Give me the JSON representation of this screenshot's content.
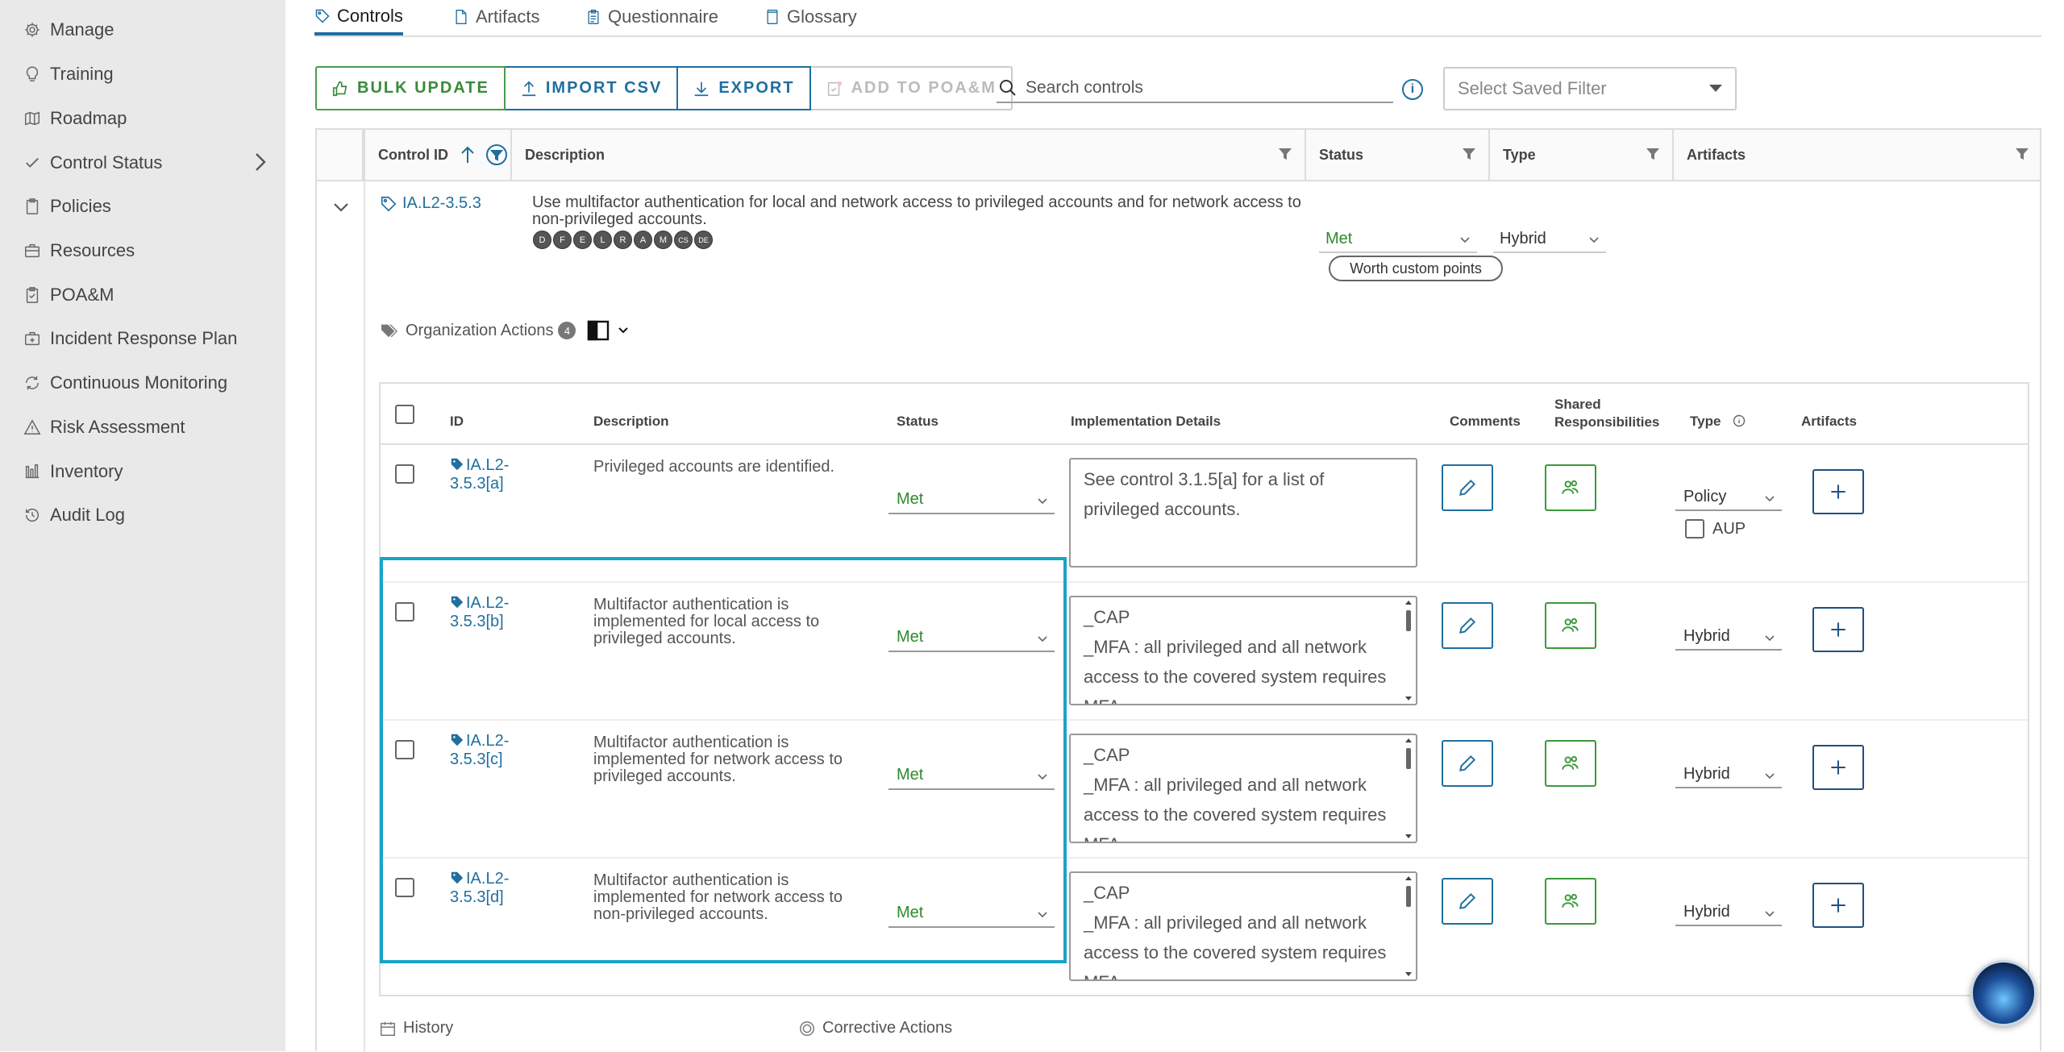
{
  "sidebar": {
    "items": [
      {
        "label": "Manage",
        "icon": "gear-icon"
      },
      {
        "label": "Training",
        "icon": "lightbulb-icon"
      },
      {
        "label": "Roadmap",
        "icon": "map-icon"
      },
      {
        "label": "Control Status",
        "icon": "checkmark-icon"
      },
      {
        "label": "Policies",
        "icon": "clipboard-icon"
      },
      {
        "label": "Resources",
        "icon": "briefcase-icon"
      },
      {
        "label": "POA&M",
        "icon": "clipboard-check-icon"
      },
      {
        "label": "Incident Response Plan",
        "icon": "first-aid-icon"
      },
      {
        "label": "Continuous Monitoring",
        "icon": "cycle-icon"
      },
      {
        "label": "Risk Assessment",
        "icon": "warning-icon"
      },
      {
        "label": "Inventory",
        "icon": "bar-chart-icon"
      },
      {
        "label": "Audit Log",
        "icon": "history-icon"
      }
    ]
  },
  "tabs": [
    "Controls",
    "Artifacts",
    "Questionnaire",
    "Glossary"
  ],
  "toolbar": {
    "bulk_update": "BULK UPDATE",
    "import_csv": "IMPORT CSV",
    "export": "EXPORT",
    "add_poam": "ADD TO POA&M",
    "search_placeholder": "Search controls",
    "saved_filter_placeholder": "Select Saved Filter"
  },
  "grid_headers": {
    "control_id": "Control ID",
    "description": "Description",
    "status": "Status",
    "type": "Type",
    "artifacts": "Artifacts"
  },
  "control": {
    "id": "IA.L2-3.5.3",
    "description": "Use multifactor authentication for local and network access to privileged accounts and for network access to non-privileged accounts.",
    "badges": [
      "D",
      "F",
      "E",
      "L",
      "R",
      "A",
      "M",
      "CS",
      "DE"
    ],
    "status": "Met",
    "type": "Hybrid",
    "points_pill": "Worth custom points"
  },
  "org_actions": {
    "label": "Organization Actions",
    "count": "4",
    "headers": {
      "id": "ID",
      "description": "Description",
      "status": "Status",
      "implementation": "Implementation Details",
      "comments": "Comments",
      "shared": "Shared Responsibilities",
      "type": "Type",
      "artifacts": "Artifacts"
    },
    "rows": [
      {
        "id": "IA.L2-3.5.3[a]",
        "description": "Privileged accounts are identified.",
        "status": "Met",
        "impl": "See control 3.1.5[a] for a list of privileged accounts.",
        "type": "Policy",
        "aup_label": "AUP"
      },
      {
        "id": "IA.L2-3.5.3[b]",
        "description": "Multifactor authentication is implemented for local access to privileged accounts.",
        "status": "Met",
        "impl": "_CAP\n_MFA : all privileged and all network access to the covered system requires MFA",
        "type": "Hybrid"
      },
      {
        "id": "IA.L2-3.5.3[c]",
        "description": "Multifactor authentication is implemented for network access to privileged accounts.",
        "status": "Met",
        "impl": "_CAP\n_MFA : all privileged and all network access to the covered system requires MFA",
        "type": "Hybrid"
      },
      {
        "id": "IA.L2-3.5.3[d]",
        "description": "Multifactor authentication is implemented for network access to non-privileged accounts.",
        "status": "Met",
        "impl": "_CAP\n_MFA : all privileged and all network access to the covered system requires MFA",
        "type": "Hybrid"
      }
    ]
  },
  "footer": {
    "history": "History",
    "corrective": "Corrective Actions"
  },
  "colors": {
    "accent": "#1f6f9f",
    "green": "#3aa03a",
    "highlight": "#1aa3c8"
  }
}
